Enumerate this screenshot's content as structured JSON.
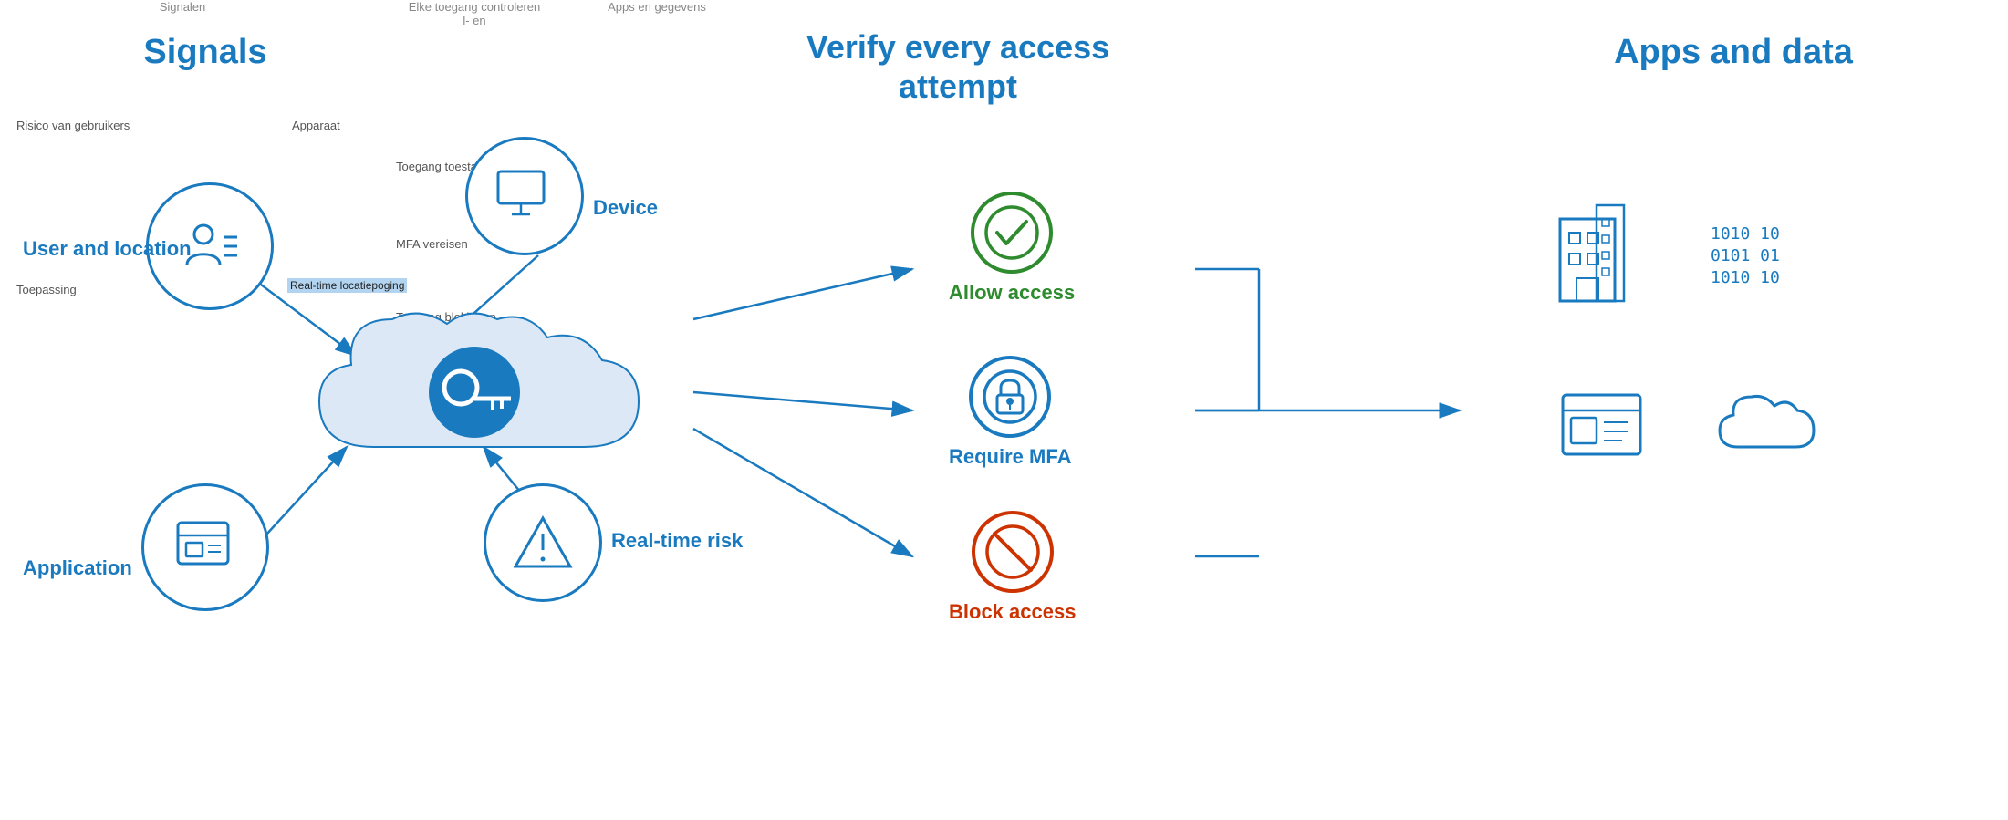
{
  "headers": {
    "signals_nl": "Signalen",
    "verify_nl": "Elke toegang controleren",
    "apps_nl": "Apps en gegevens",
    "verify_nl2": "l- en"
  },
  "sections": {
    "signals_title": "Signals",
    "verify_title": "Verify every access attempt",
    "apps_title": "Apps and data"
  },
  "signals": {
    "user_location_label": "User and location",
    "application_label": "Application",
    "device_label": "Device",
    "realtime_label": "Real-time risk"
  },
  "small_labels": {
    "user_risk": "Risico van gebruikers",
    "device": "Apparaat",
    "application": "Toepassing",
    "allow_access_nl": "Toegang toestaan",
    "require_mfa_nl": "MFA vereisen",
    "block_nl": "Toegang blokkeren",
    "realtime_nl": "Real-time locatiepoging"
  },
  "outcomes": {
    "allow": {
      "label": "Allow access",
      "color": "#2e8b2e"
    },
    "mfa": {
      "label": "Require MFA",
      "color": "#1a7abf"
    },
    "block": {
      "label": "Block access",
      "color": "#cc3300"
    }
  }
}
